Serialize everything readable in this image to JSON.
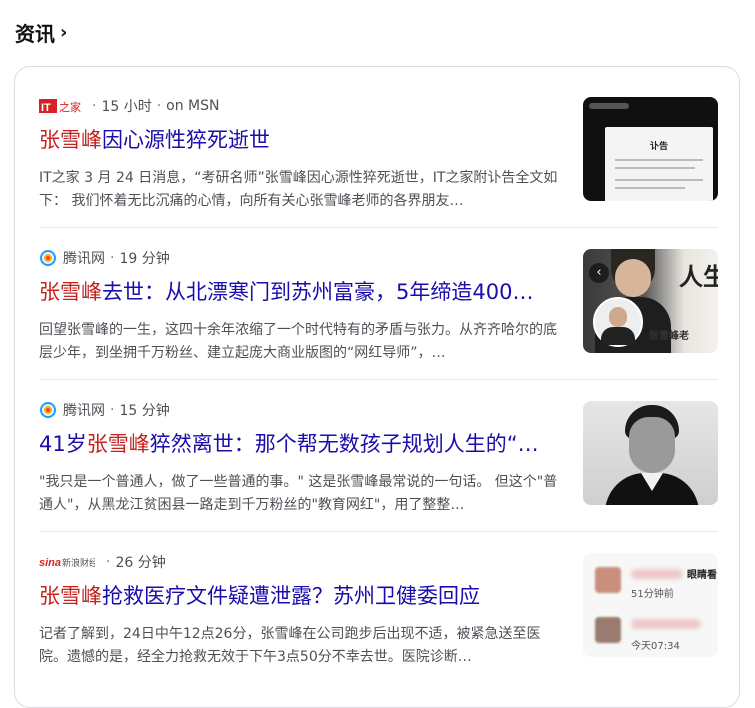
{
  "header": {
    "title": "资讯",
    "chevron": "›"
  },
  "items": [
    {
      "source": "IT之家",
      "logo_text": "IT之家",
      "meta_time": "15 小时",
      "meta_via": "on MSN",
      "title_highlight": "张雪峰",
      "title_rest": "因心源性猝死逝世",
      "snippet": "IT之家 3 月 24 日消息，“考研名师”张雪峰因心源性猝死逝世，IT之家附讣告全文如下： 我们怀着无比沉痛的心情，向所有关心张雪峰老师的各界朋友…",
      "thumb_text": "讣告"
    },
    {
      "source": "腾讯网",
      "meta_time": "19 分钟",
      "title_highlight": "张雪峰",
      "title_rest": "去世：从北漂寒门到苏州富豪，5年缔造400…",
      "snippet": "回望张雪峰的一生，这四十余年浓缩了一个时代特有的矛盾与张力。从齐齐哈尔的底层少年，到坐拥千万粉丝、建立起庞大商业版图的“网红导师”，…",
      "thumb_big": "人生",
      "thumb_tag": "张雪峰老"
    },
    {
      "source": "腾讯网",
      "meta_time": "15 分钟",
      "title_prefix": "41岁",
      "title_highlight": "张雪峰",
      "title_rest": "猝然离世：那个帮无数孩子规划人生的“…",
      "snippet": "\"我只是一个普通人，做了一些普通的事。\" 这是张雪峰最常说的一句话。 但这个\"普通人\"，从黑龙江贫困县一路走到千万粉丝的\"教育网红\"，用了整整…"
    },
    {
      "source": "新浪财经",
      "logo_text": "新浪财经",
      "meta_time": "26 分钟",
      "title_highlight": "张雪峰",
      "title_rest": "抢救医疗文件疑遭泄露？苏州卫健委回应",
      "snippet": "记者了解到，24日中午12点26分，张雪峰在公司跑步后出现不适，被紧急送至医院。遗憾的是，经全力抢救无效于下午3点50分不幸去世。医院诊断…",
      "thumb_line1": "眼睛看",
      "thumb_time1": "51分钟前",
      "thumb_time2": "今天07:34"
    }
  ],
  "colors": {
    "title": "#1a0dab",
    "highlight": "#c5221f",
    "meta": "#4d5156"
  }
}
